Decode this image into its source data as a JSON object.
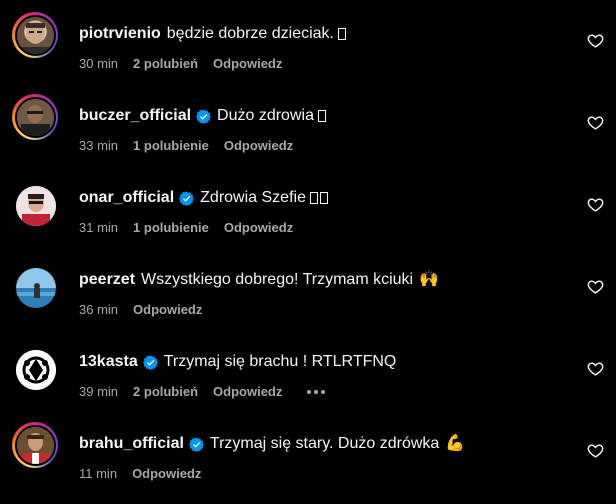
{
  "colors": {
    "background": "#000000",
    "text": "#f5f5f5",
    "meta": "#a8a8a8",
    "verified": "#0095f6",
    "story_ring": [
      "#feda75",
      "#fa7e1e",
      "#d62976",
      "#962fbf",
      "#4f5bd5"
    ]
  },
  "icons": {
    "like": "heart-outline-icon",
    "verified": "verified-badge-icon",
    "options": "more-options-icon"
  },
  "comments": [
    {
      "username": "piotrvienio",
      "verified": false,
      "text": "będzie dobrze dzieciak.",
      "emoji": "box",
      "time": "30 min",
      "likes": "2 polubień",
      "reply": "Odpowiedz",
      "story_ring": true
    },
    {
      "username": "buczer_official",
      "verified": true,
      "text": "Dużo zdrowia",
      "emoji": "box",
      "time": "33 min",
      "likes": "1 polubienie",
      "reply": "Odpowiedz",
      "story_ring": true
    },
    {
      "username": "onar_official",
      "verified": true,
      "text": "Zdrowia Szefie",
      "emoji": "box-box",
      "time": "31 min",
      "likes": "1 polubienie",
      "reply": "Odpowiedz",
      "story_ring": false
    },
    {
      "username": "peerzet",
      "verified": false,
      "text": "Wszystkiego dobrego! Trzymam kciuki",
      "emoji": "🙌",
      "time": "36 min",
      "likes": "",
      "reply": "Odpowiedz",
      "story_ring": false
    },
    {
      "username": "13kasta",
      "verified": true,
      "text": "Trzymaj się brachu ! RTLRTFNQ",
      "emoji": "",
      "time": "39 min",
      "likes": "2 polubień",
      "reply": "Odpowiedz",
      "story_ring": false,
      "show_options": true
    },
    {
      "username": "brahu_official",
      "verified": true,
      "text": "Trzymaj się stary. Dużo zdrówka",
      "emoji": "💪",
      "time": "11 min",
      "likes": "",
      "reply": "Odpowiedz",
      "story_ring": true
    }
  ]
}
